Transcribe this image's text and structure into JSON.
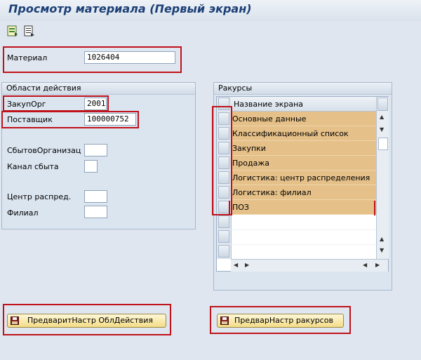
{
  "window": {
    "title": "Просмотр материала (Первый экран)"
  },
  "toolbar": {
    "items": [
      {
        "icon": "data-select-icon"
      },
      {
        "icon": "view-detail-icon"
      }
    ]
  },
  "material": {
    "label": "Материал",
    "value": "1026404"
  },
  "org_levels": {
    "title": "Области действия",
    "purch_org": {
      "label": "ЗакупОрг",
      "value": "2001"
    },
    "vendor": {
      "label": "Поставщик",
      "value": "100000752"
    },
    "sales_org": {
      "label": "СбытовОрганизац",
      "value": ""
    },
    "dist_channel": {
      "label": "Канал сбыта",
      "value": ""
    },
    "dist_center": {
      "label": "Центр распред.",
      "value": ""
    },
    "branch": {
      "label": "Филиал",
      "value": ""
    }
  },
  "views": {
    "title": "Ракурсы",
    "column_header": "Название экрана",
    "rows": [
      "Основные данные",
      "Классификационный список",
      "Закупки",
      "Продажа",
      "Логистика: центр распределения",
      "Логистика: филиал",
      "ПОЗ"
    ],
    "selected_color": "#e5c088"
  },
  "buttons": {
    "org_defaults": "ПредваритНастр ОблДействия",
    "view_defaults": "ПредварНастр ракурсов"
  },
  "colors": {
    "highlight": "#c0121a",
    "title": "#1c3f76"
  }
}
